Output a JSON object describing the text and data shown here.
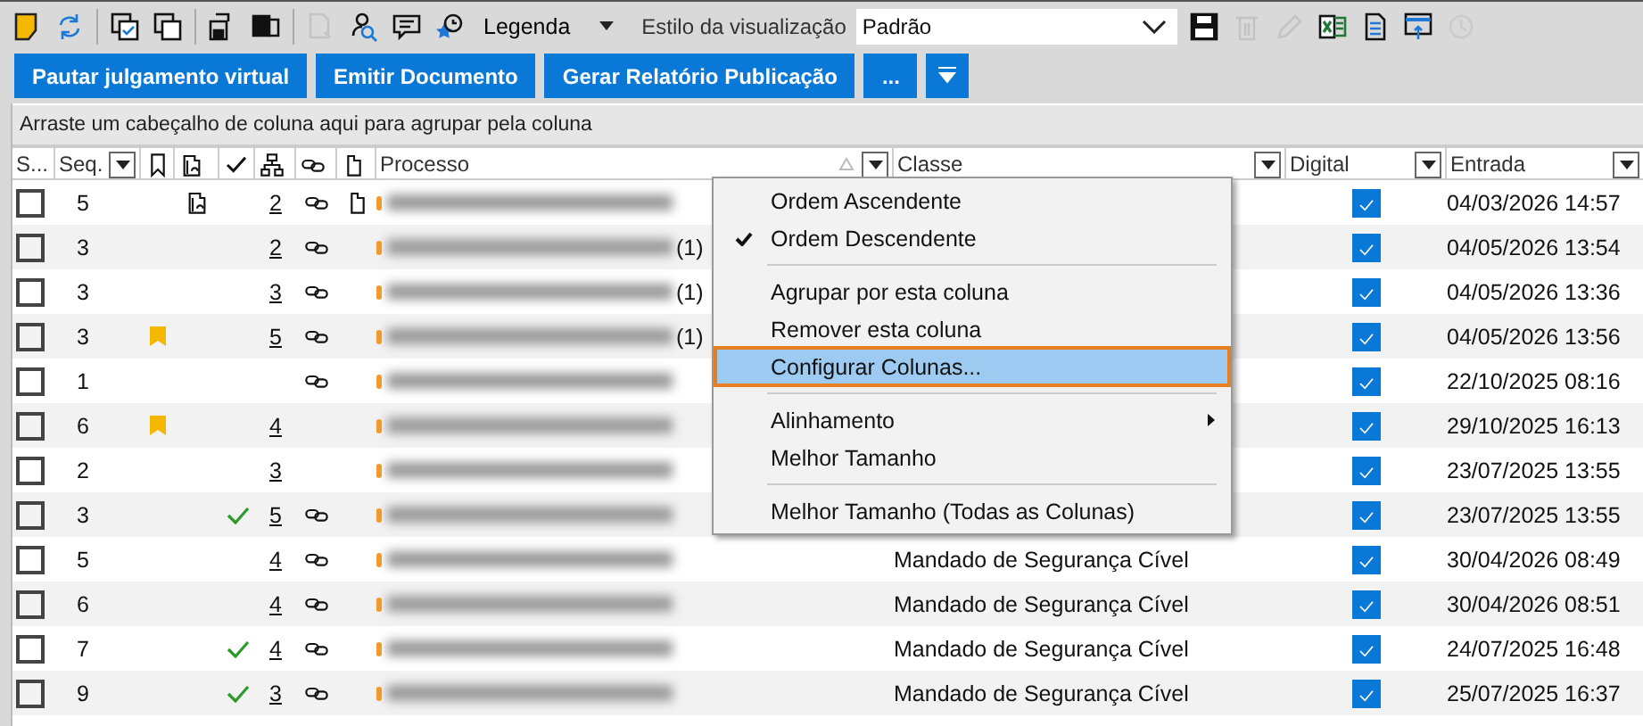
{
  "toolbar": {
    "left_icons": [
      {
        "kind": "note",
        "disabled": false
      },
      {
        "kind": "refresh",
        "disabled": false
      },
      {
        "kind": "window-check",
        "disabled": false
      },
      {
        "kind": "windows",
        "disabled": false
      },
      {
        "kind": "save-doc",
        "disabled": false
      },
      {
        "kind": "save-window",
        "disabled": false
      },
      {
        "kind": "doc-export",
        "disabled": true
      },
      {
        "kind": "search-user",
        "disabled": false
      },
      {
        "kind": "comment",
        "disabled": false
      },
      {
        "kind": "star-pin",
        "disabled": false
      }
    ],
    "legend": {
      "label": "Legenda"
    },
    "view_style": {
      "label": "Estilo da visualização",
      "value": "Padrão"
    },
    "right_icons": [
      {
        "kind": "save",
        "disabled": false
      },
      {
        "kind": "trash",
        "disabled": true
      },
      {
        "kind": "pencil",
        "disabled": true
      },
      {
        "kind": "excel",
        "disabled": false
      },
      {
        "kind": "document",
        "disabled": false
      },
      {
        "kind": "window-upload",
        "disabled": false
      },
      {
        "kind": "history",
        "disabled": true
      }
    ]
  },
  "actions": [
    "Pautar julgamento virtual",
    "Emitir Documento",
    "Gerar Relatório Publicação",
    "..."
  ],
  "group_panel": {
    "hint": "Arraste um cabeçalho de coluna aqui para agrupar pela coluna"
  },
  "columns": [
    {
      "kind": "text",
      "label": "S...",
      "filter": false,
      "sorted": false
    },
    {
      "kind": "text",
      "label": "Seq.",
      "filter": true,
      "sorted": false
    },
    {
      "kind": "icon"
    },
    {
      "kind": "icon"
    },
    {
      "kind": "icon"
    },
    {
      "kind": "icon"
    },
    {
      "kind": "icon"
    },
    {
      "kind": "icon"
    },
    {
      "kind": "text",
      "label": "Processo",
      "filter": true,
      "sorted": true
    },
    {
      "kind": "text",
      "label": "Classe",
      "filter": true,
      "sorted": false
    },
    {
      "kind": "text",
      "label": "Digital",
      "filter": true,
      "sorted": false
    },
    {
      "kind": "text",
      "label": "Entrada",
      "filter": true,
      "sorted": false
    }
  ],
  "rows": [
    {
      "selected": false,
      "seq": "5",
      "flags": [
        {
          "kind": "attach"
        },
        {
          "kind": "link"
        },
        {
          "kind": "doc"
        }
      ],
      "count": "2",
      "digital": true,
      "entrada": "04/03/2026 14:57"
    },
    {
      "selected": false,
      "seq": "3",
      "flags": [
        {
          "kind": "link"
        }
      ],
      "count": "2",
      "suffix": "(1)",
      "digital": true,
      "entrada": "04/05/2026 13:54"
    },
    {
      "selected": false,
      "seq": "3",
      "flags": [
        {
          "kind": "link"
        }
      ],
      "count": "3",
      "suffix": "(1)",
      "digital": true,
      "entrada": "04/05/2026 13:36"
    },
    {
      "selected": false,
      "seq": "3",
      "flags": [
        {
          "kind": "bookmark"
        },
        {
          "kind": "link"
        }
      ],
      "count": "5",
      "suffix": "(1)",
      "digital": true,
      "entrada": "04/05/2026 13:56"
    },
    {
      "selected": false,
      "seq": "1",
      "flags": [
        {
          "kind": "link"
        }
      ],
      "digital": true,
      "entrada": "22/10/2025 08:16"
    },
    {
      "selected": false,
      "seq": "6",
      "flags": [
        {
          "kind": "bookmark"
        }
      ],
      "count": "4",
      "digital": true,
      "entrada": "29/10/2025 16:13"
    },
    {
      "selected": false,
      "seq": "2",
      "flags": [],
      "count": "3",
      "digital": true,
      "entrada": "23/07/2025 13:55"
    },
    {
      "selected": false,
      "seq": "3",
      "flags": [
        {
          "kind": "done"
        },
        {
          "kind": "link"
        }
      ],
      "count": "5",
      "digital": true,
      "entrada": "23/07/2025 13:55"
    },
    {
      "selected": false,
      "seq": "5",
      "flags": [
        {
          "kind": "link"
        }
      ],
      "count": "4",
      "classe": "Mandado de Segurança Cível",
      "digital": true,
      "entrada": "30/04/2026 08:49"
    },
    {
      "selected": false,
      "seq": "6",
      "flags": [
        {
          "kind": "link"
        }
      ],
      "count": "4",
      "classe": "Mandado de Segurança Cível",
      "digital": true,
      "entrada": "30/04/2026 08:51"
    },
    {
      "selected": false,
      "seq": "7",
      "flags": [
        {
          "kind": "done"
        },
        {
          "kind": "link"
        }
      ],
      "count": "4",
      "classe": "Mandado de Segurança Cível",
      "digital": true,
      "entrada": "24/07/2025 16:48"
    },
    {
      "selected": false,
      "seq": "9",
      "flags": [
        {
          "kind": "done"
        },
        {
          "kind": "link"
        }
      ],
      "count": "3",
      "classe": "Mandado de Segurança Cível",
      "digital": true,
      "entrada": "25/07/2025 16:37"
    }
  ],
  "context_menu": {
    "items": [
      {
        "kind": "item",
        "label": "Ordem Ascendente",
        "checked": false,
        "selected": false
      },
      {
        "kind": "item",
        "label": "Ordem Descendente",
        "checked": true,
        "selected": false
      },
      {
        "kind": "separator"
      },
      {
        "kind": "item",
        "label": "Agrupar por esta coluna",
        "checked": false,
        "selected": false
      },
      {
        "kind": "item",
        "label": "Remover esta coluna",
        "checked": false,
        "selected": false
      },
      {
        "kind": "item",
        "label": "Configurar Colunas...",
        "checked": false,
        "selected": true
      },
      {
        "kind": "separator"
      },
      {
        "kind": "submenu",
        "label": "Alinhamento",
        "checked": false,
        "selected": false
      },
      {
        "kind": "item",
        "label": "Melhor Tamanho",
        "checked": false,
        "selected": false
      },
      {
        "kind": "separator"
      },
      {
        "kind": "item",
        "label": "Melhor Tamanho (Todas as Colunas)",
        "checked": false,
        "selected": false
      }
    ]
  }
}
